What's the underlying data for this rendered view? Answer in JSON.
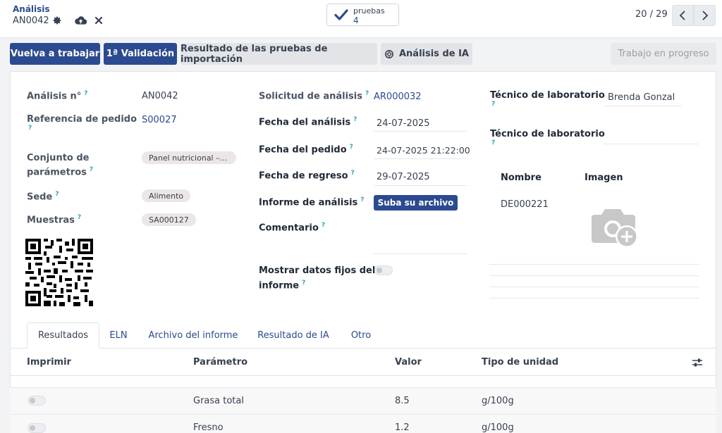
{
  "breadcrumb": {
    "parent": "Análisis",
    "record": "AN0042"
  },
  "stat": {
    "label": "pruebas",
    "value": "4"
  },
  "pager": {
    "text": "20 / 29"
  },
  "actions": {
    "rework": "Vuelva a trabajar",
    "validation": "1ª Validación",
    "import_results": "Resultado de las pruebas de importación",
    "ai_analysis": "Análisis de IA",
    "status": "Trabajo en progreso"
  },
  "form": {
    "analysis_no": {
      "label": "Análisis n°",
      "value": "AN0042"
    },
    "order_ref": {
      "label": "Referencia de pedido",
      "value": "S00027"
    },
    "param_set": {
      "label_1": "Conjunto de",
      "label_2": "parámetros",
      "value": "Panel nutricional –..."
    },
    "site": {
      "label": "Sede",
      "value": "Alimento"
    },
    "samples": {
      "label": "Muestras",
      "value": "SA000127"
    },
    "request": {
      "label": "Solicitud de análisis",
      "value": "AR000032"
    },
    "analysis_date": {
      "label": "Fecha del análisis",
      "value": "24-07-2025"
    },
    "order_date": {
      "label": "Fecha del pedido",
      "value": "24-07-2025 21:22:00"
    },
    "return_date": {
      "label": "Fecha de regreso",
      "value": "29-07-2025"
    },
    "report": {
      "label": "Informe de análisis",
      "button": "Suba su archivo"
    },
    "comment": {
      "label": "Comentario"
    },
    "fixed_data": {
      "label_1": "Mostrar datos fijos del",
      "label_2": "informe"
    },
    "lab_tech_1": {
      "label": "Técnico de laboratorio",
      "value": "Brenda Gonzal"
    },
    "lab_tech_2": {
      "label": "Técnico de laboratorio",
      "value": ""
    },
    "sub_table": {
      "col_name": "Nombre",
      "col_image": "Imagen",
      "row_name": "DE000221"
    },
    "help": "?"
  },
  "tabs": [
    "Resultados",
    "ELN",
    "Archivo del informe",
    "Resultado de IA",
    "Otro"
  ],
  "results": {
    "columns": [
      "Imprimir",
      "Parámetro",
      "Valor",
      "Tipo de unidad"
    ],
    "rows": [
      {
        "parameter": "Grasa total",
        "value": "8.5",
        "unit": "g/100g"
      },
      {
        "parameter": "Fresno",
        "value": "1.2",
        "unit": "g/100g"
      }
    ]
  },
  "colors": {
    "primary": "#2b4a8f",
    "help": "#2aa3b5",
    "tag": "#ece6e6"
  }
}
